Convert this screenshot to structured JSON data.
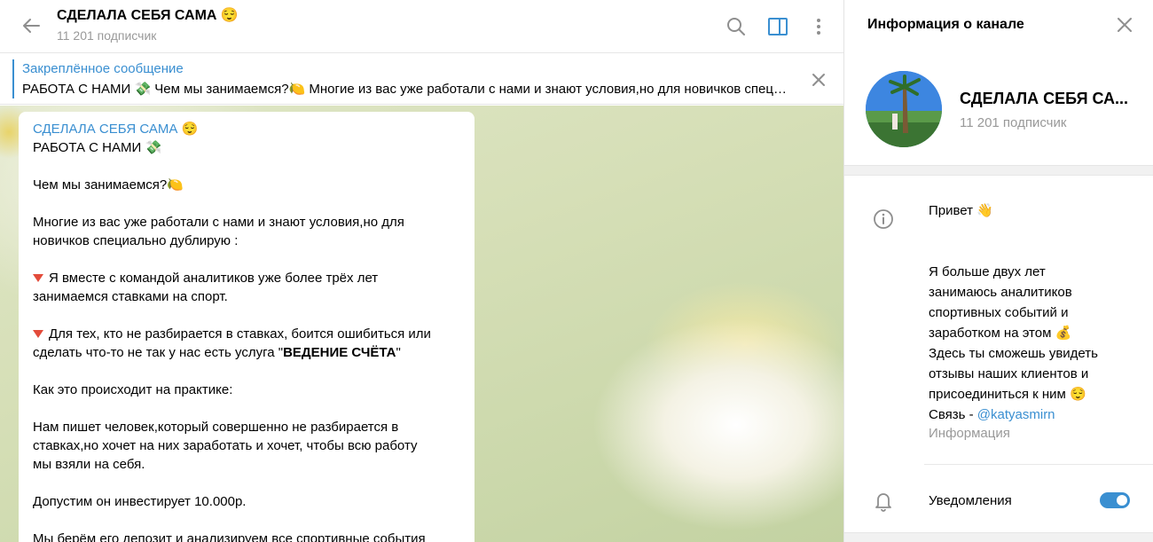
{
  "chat": {
    "title": "СДЕЛАЛА СЕБЯ САМА 😌",
    "subscribers": "11 201 подписчик",
    "icons": [
      "back-arrow-icon",
      "search-icon",
      "sidebar-toggle-icon",
      "more-vertical-icon"
    ]
  },
  "pinned": {
    "title": "Закреплённое сообщение",
    "text": "РАБОТА С НАМИ 💸  Чем мы занимаемся?🍋  Многие из вас уже работали с нами и знают условия,но для новичков специально дублирую :",
    "close_icon": "close-icon"
  },
  "message": {
    "author": "СДЕЛАЛА СЕБЯ САМА 😌",
    "line1": "РАБОТА С НАМИ 💸",
    "line2": "Чем мы занимаемся?🍋",
    "line3": "Многие из вас уже работали с нами и знают условия,но для",
    "line4": "новичков специально дублирую :",
    "line5": "Я вместе с командой аналитиков уже более трёх лет",
    "line6": "занимаемся ставками на спорт.",
    "line7": "Для тех, кто не разбирается в ставках, боится ошибиться или",
    "line8a": "сделать что-то не так у нас есть услуга \"",
    "line8b": "ВЕДЕНИЕ СЧЁТА",
    "line8c": "\"",
    "line9": "Как это происходит на практике:",
    "line10": "Нам пишет человек,который совершенно не разбирается в",
    "line11": "ставках,но хочет на них заработать и хочет, чтобы всю работу",
    "line12": "мы взяли на себя.",
    "line13": "Допустим он инвестирует 10.000р.",
    "line14": "Мы берём его депозит и анализируем все спортивные события"
  },
  "info": {
    "header_title": "Информация о канале",
    "channel_name": "СДЕЛАЛА СЕБЯ СА...",
    "subscribers": "11 201 подписчик",
    "desc": {
      "l1": "Привет 👋",
      "l2": "Я больше двух лет",
      "l3": "занимаюсь аналитиков",
      "l4": "спортивных событий и",
      "l5": "заработком на этом 💰",
      "l6": "Здесь ты сможешь увидеть",
      "l7": "отзывы наших клиентов и",
      "l8": "присоединиться к ним 😌",
      "l9_prefix": "Связь - ",
      "l9_link": "@katyasmirn"
    },
    "desc_caption": "Информация",
    "notifications_label": "Уведомления",
    "notifications_on": true,
    "accent_color": "#3a8fd1"
  }
}
